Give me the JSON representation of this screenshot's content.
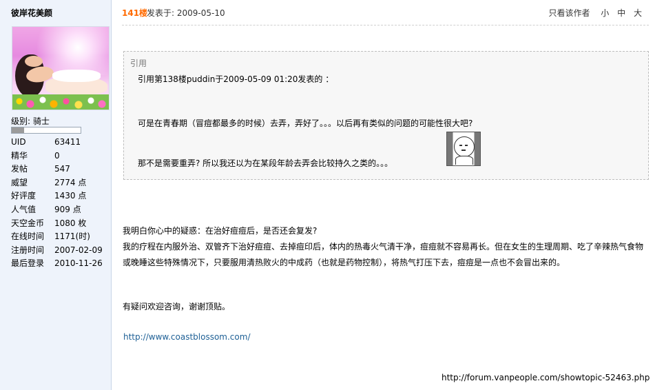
{
  "user": {
    "name": "彼岸花美颜",
    "level": "级别: 骑士",
    "level_progress": 0.18,
    "stats": [
      {
        "label": "UID",
        "value": "63411"
      },
      {
        "label": "精华",
        "value": "0"
      },
      {
        "label": "发帖",
        "value": "547"
      },
      {
        "label": "威望",
        "value": "2774 点"
      },
      {
        "label": "好评度",
        "value": "1430 点"
      },
      {
        "label": "人气值",
        "value": "909 点"
      },
      {
        "label": "天空金币",
        "value": "1080 枚"
      },
      {
        "label": "在线时间",
        "value": "1171(时)"
      },
      {
        "label": "注册时间",
        "value": "2007-02-09"
      },
      {
        "label": "最后登录",
        "value": "2010-11-26"
      }
    ]
  },
  "post": {
    "floor": "141楼",
    "posted": "发表于: 2009-05-10",
    "only_author": "只看该作者",
    "font_small": "小",
    "font_medium": "中",
    "font_large": "大",
    "quote": {
      "label": "引用",
      "ref": "引用第138楼puddin于2009-05-09 01:20发表的 ：",
      "line1": "可是在青春期（冒痘都最多的时候）去弄，弄好了。。。以后再有类似的问题的可能性很大吧?",
      "line2": "那不是需要重弄? 所以我还以为在某段年龄去弄会比较持久之类的。。。",
      "emoticon": "sweat-emoticon"
    },
    "body_line1": "我明白你心中的疑惑：在治好痘痘后，是否还会复发?",
    "body_para2": "我的疗程在内服外治、双管齐下治好痘痘、去掉痘印后，体内的热毒火气清干净，痘痘就不容易再长。但在女生的生理周期、吃了辛辣热气食物或晚睡这些特殊情况下，只要服用清热败火的中成药（也就是药物控制），将热气打压下去，痘痘是一点也不会冒出来的。",
    "body_line3": "有疑问欢迎咨询，谢谢顶贴。",
    "link": "http://www.coastblossom.com/"
  },
  "footer_url": "http://forum.vanpeople.com/showtopic-52463.php"
}
